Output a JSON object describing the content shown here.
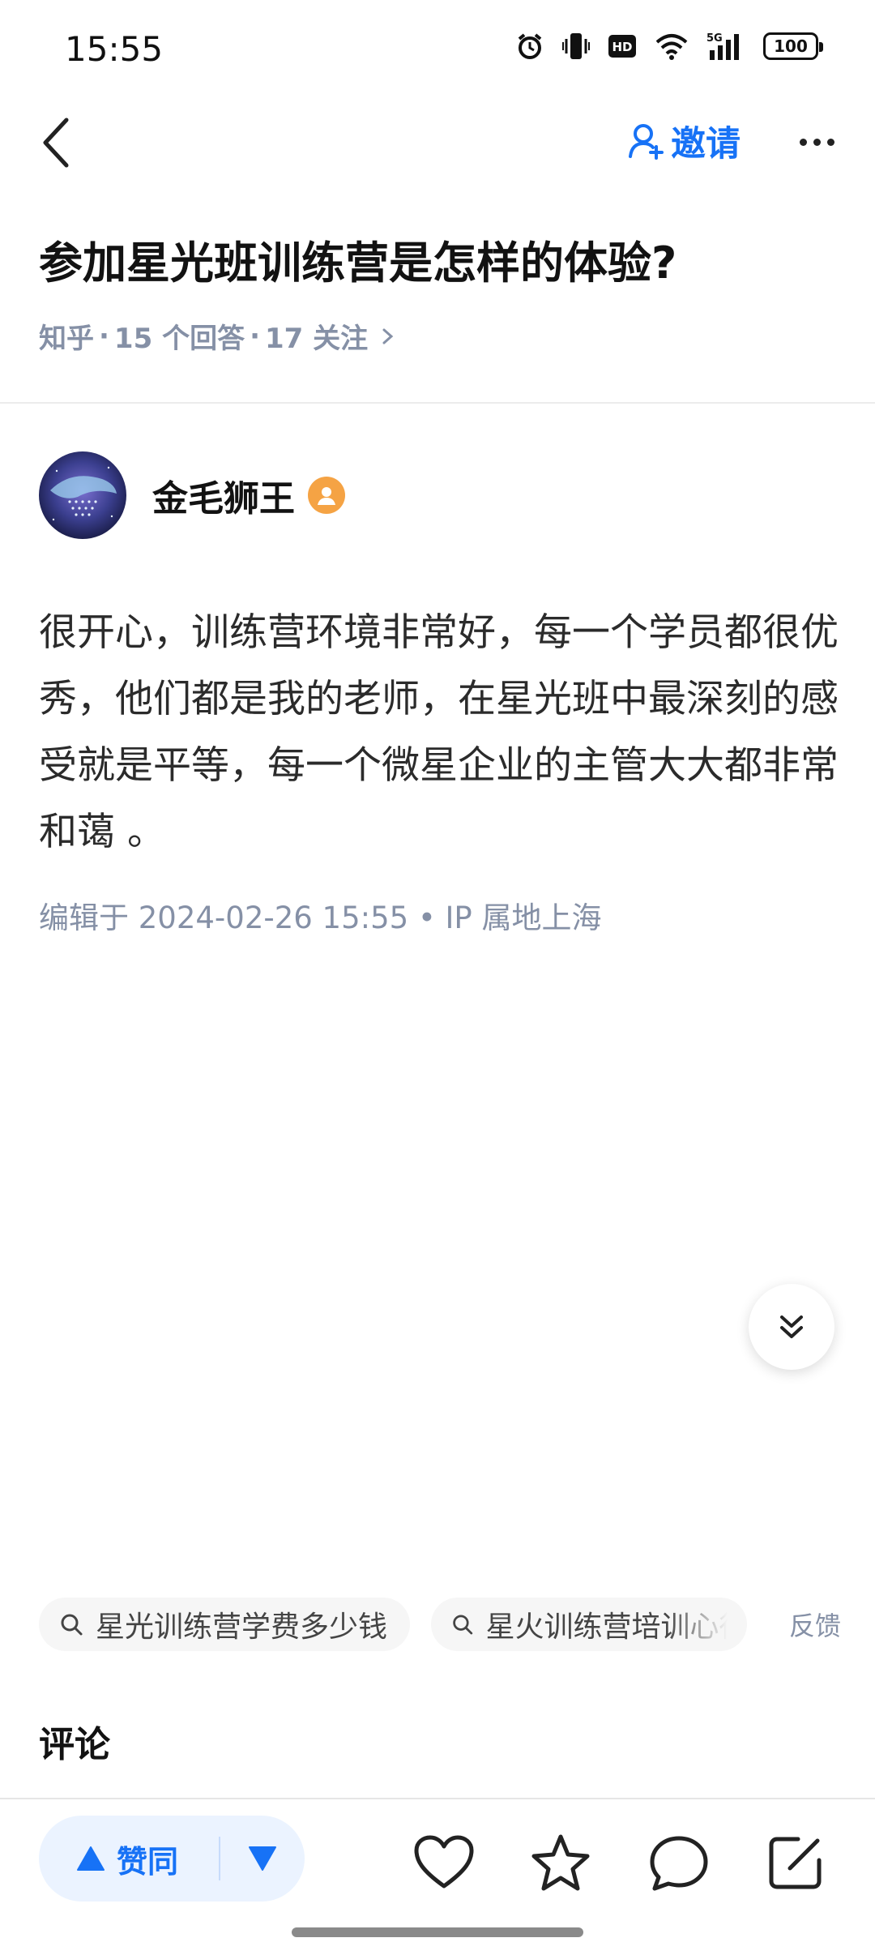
{
  "status_bar": {
    "time": "15:55",
    "battery": "100",
    "icons": [
      "alarm-icon",
      "vibrate-icon",
      "hd-icon",
      "wifi-icon",
      "5g-signal-icon",
      "battery-icon"
    ]
  },
  "nav": {
    "invite_label": "邀请",
    "icons": [
      "back-icon",
      "invite-user-icon",
      "more-icon"
    ]
  },
  "question": {
    "title": "参加星光班训练营是怎样的体验?",
    "source": "知乎",
    "answers": "15 个回答",
    "follows": "17 关注",
    "separator": "·"
  },
  "answer": {
    "author_name": "金毛狮王",
    "body": "很开心，训练营环境非常好，每一个学员都很优秀，他们都是我的老师，在星光班中最深刻的感受就是平等，每一个微星企业的主管大大都非常和蔼 。",
    "edited_meta": "编辑于 2024-02-26 15:55 • IP 属地上海"
  },
  "related_searches": [
    {
      "label": "星光训练营学费多少钱"
    },
    {
      "label": "星火训练营培训心得"
    }
  ],
  "feedback_label": "反馈",
  "comments_label": "评论",
  "bottom_bar": {
    "upvote_label": "赞同",
    "icons": [
      "upvote-icon",
      "downvote-icon",
      "like-heart-icon",
      "favorite-star-icon",
      "comment-icon",
      "edit-icon"
    ]
  },
  "colors": {
    "accent": "#1772f6",
    "meta_text": "#8590a6",
    "vote_bg": "#ebf3ff",
    "badge": "#f5a344"
  }
}
